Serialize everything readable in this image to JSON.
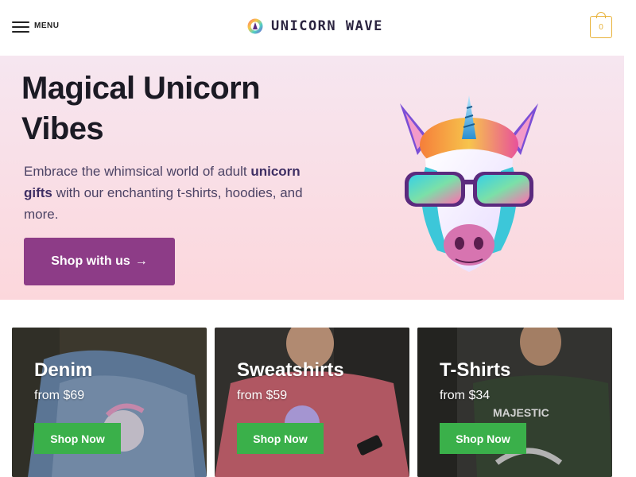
{
  "header": {
    "menu_label": "MENU",
    "logo_text": "UNICORN WAVE",
    "cart_count": "0"
  },
  "hero": {
    "title": "Magical Unicorn Vibes",
    "text_before": "Embrace the whimsical world of adult ",
    "text_bold": "unicorn gifts",
    "text_after": " with our enchanting t-shirts, hoodies, and more.",
    "cta_label": "Shop with us",
    "cta_arrow": "→"
  },
  "categories": [
    {
      "title": "Denim",
      "price": "from $69",
      "button": "Shop Now"
    },
    {
      "title": "Sweatshirts",
      "price": "from $59",
      "button": "Shop Now"
    },
    {
      "title": "T-Shirts",
      "price": "from $34",
      "button": "Shop Now"
    }
  ],
  "colors": {
    "cta_purple": "#8d3c87",
    "shop_green": "#3ab04a",
    "cart_gold": "#e8b23a",
    "hero_top": "#f6e6f0",
    "hero_bottom": "#fcd7dc"
  },
  "icons": {
    "menu": "hamburger-icon",
    "logo": "unicorn-logo-icon",
    "cart": "shopping-bag-icon",
    "cta": "arrow-right-icon"
  }
}
